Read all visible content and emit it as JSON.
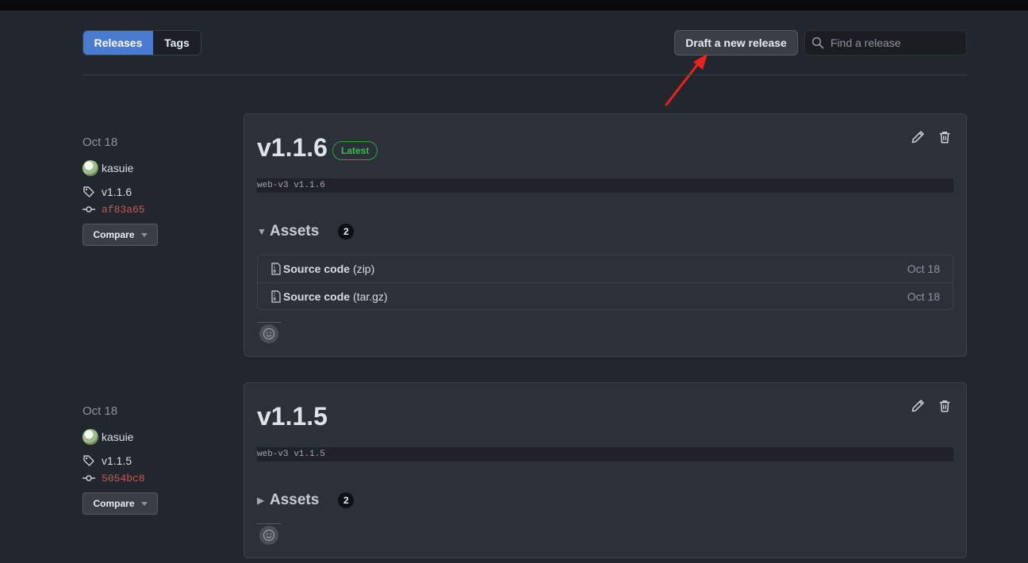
{
  "nav": {
    "tabs": [
      {
        "label": "Releases"
      },
      {
        "label": "Tags"
      }
    ]
  },
  "header": {
    "draft_label": "Draft a new release",
    "search_placeholder": "Find a release"
  },
  "colors": {
    "accent": "#4b7bd0",
    "latest_green": "#3fb950",
    "commit_red": "#c25a5a"
  },
  "releases": [
    {
      "date": "Oct 18",
      "author": "kasuie",
      "tag": "v1.1.6",
      "commit": "af83a65",
      "compare_label": "Compare",
      "title": "v1.1.6",
      "badge": "Latest",
      "body": "web-v3 v1.1.6",
      "assets_label": "Assets",
      "assets_count": "2",
      "assets_expanded": true,
      "assets": [
        {
          "name": "Source code",
          "ext": "(zip)",
          "date": "Oct 18"
        },
        {
          "name": "Source code",
          "ext": "(tar.gz)",
          "date": "Oct 18"
        }
      ]
    },
    {
      "date": "Oct 18",
      "author": "kasuie",
      "tag": "v1.1.5",
      "commit": "5054bc8",
      "compare_label": "Compare",
      "title": "v1.1.5",
      "body": "web-v3 v1.1.5",
      "assets_label": "Assets",
      "assets_count": "2",
      "assets_expanded": false
    }
  ],
  "icons": {
    "tag": "tag-icon",
    "commit": "commit-icon",
    "edit": "pencil-icon",
    "delete": "trash-icon",
    "search": "search-icon",
    "file": "file-zip-icon",
    "reaction": "smiley-icon"
  }
}
